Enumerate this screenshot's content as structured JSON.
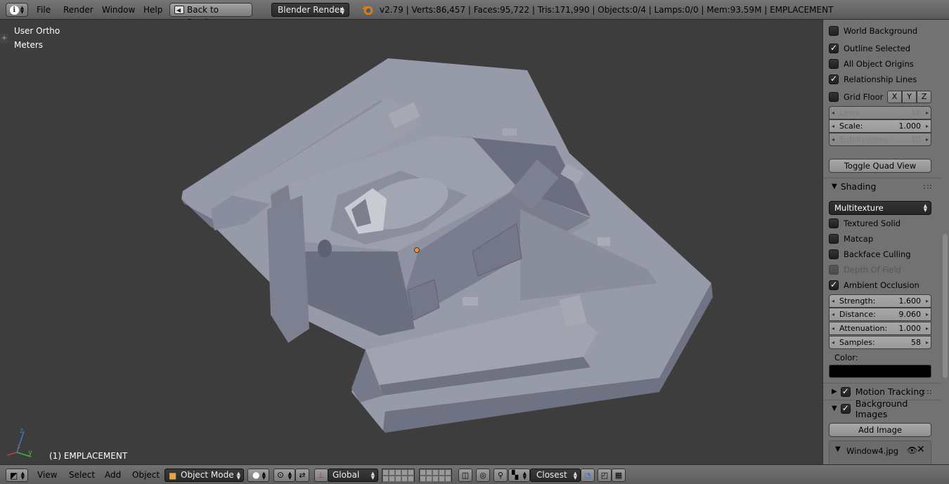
{
  "header": {
    "info_icon": "info-icon",
    "menus": [
      "File",
      "Render",
      "Window",
      "Help"
    ],
    "back_button": "Back to Previous",
    "render_engine": "Blender Render",
    "stats": "v2.79 | Verts:86,457 | Faces:95,722 | Tris:171,990 | Objects:0/4 | Lamps:0/0 | Mem:93.59M | EMPLACEMENT"
  },
  "viewport": {
    "view_name": "User Ortho",
    "units": "Meters",
    "object_label": "(1) EMPLACEMENT",
    "axis_labels": {
      "x": "x",
      "y": "y",
      "z": "z"
    },
    "model_color": "#8e8fa0",
    "background_color": "#3d3d3d"
  },
  "panel": {
    "display_checkboxes": [
      {
        "label": "World Background",
        "checked": false
      },
      {
        "label": "Outline Selected",
        "checked": true
      },
      {
        "label": "All Object Origins",
        "checked": false
      },
      {
        "label": "Relationship Lines",
        "checked": true
      },
      {
        "label": "Grid Floor",
        "checked": false
      }
    ],
    "grid_axes": [
      "X",
      "Y",
      "Z"
    ],
    "grid_fields": [
      {
        "label": "Lines:",
        "value": "16",
        "disabled": true
      },
      {
        "label": "Scale:",
        "value": "1.000",
        "disabled": false
      },
      {
        "label": "Subdivisions:",
        "value": "10",
        "disabled": true
      }
    ],
    "toggle_quad_view": "Toggle Quad View",
    "shading": {
      "title": "Shading",
      "mode": "Multitexture",
      "checkboxes": [
        {
          "label": "Textured Solid",
          "checked": false,
          "disabled": false
        },
        {
          "label": "Matcap",
          "checked": false,
          "disabled": false
        },
        {
          "label": "Backface Culling",
          "checked": false,
          "disabled": false
        },
        {
          "label": "Depth Of Field",
          "checked": false,
          "disabled": true
        },
        {
          "label": "Ambient Occlusion",
          "checked": true,
          "disabled": false
        }
      ],
      "ao_fields": [
        {
          "label": "Strength:",
          "value": "1.600"
        },
        {
          "label": "Distance:",
          "value": "9.060"
        },
        {
          "label": "Attenuation:",
          "value": "1.000"
        },
        {
          "label": "Samples:",
          "value": "58"
        }
      ],
      "color_label": "Color:",
      "color_value": "#000000"
    },
    "motion_tracking": {
      "title": "Motion Tracking",
      "checked": true
    },
    "background_images": {
      "title": "Background Images",
      "checked": true
    },
    "add_image": "Add Image",
    "image_item": "Window4.jpg"
  },
  "footer": {
    "menus": [
      "View",
      "Select",
      "Add",
      "Object"
    ],
    "mode": "Object Mode",
    "orientation": "Global",
    "snap_target": "Closest"
  }
}
